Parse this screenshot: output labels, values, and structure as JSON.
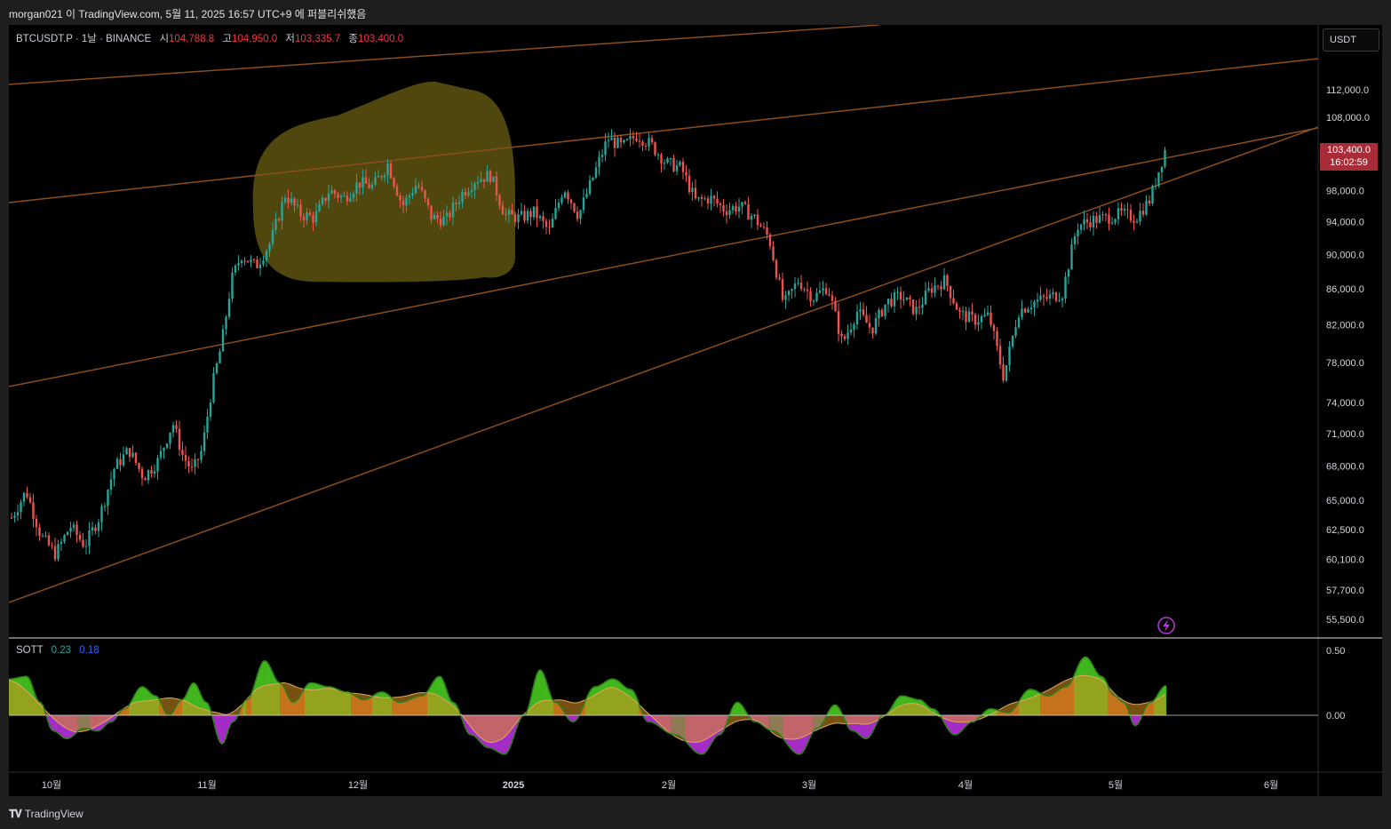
{
  "top_bar": {
    "text": "morgan021 이 TradingView.com, 5월 11, 2025 16:57 UTC+9 에 퍼블리쉬했음"
  },
  "legend": {
    "symbol": "BTCUSDT.P · 1날 · BINANCE",
    "open_label": "시",
    "open": "104,788.8",
    "high_label": "고",
    "high": "104,950.0",
    "low_label": "저",
    "low": "103,335.7",
    "close_label": "종",
    "close": "103,400.0"
  },
  "sott_legend": {
    "name": "SOTT",
    "value1": "0.23",
    "value2": "0.18"
  },
  "currency_button": "USDT",
  "price_tag": {
    "price": "103,400.0",
    "countdown": "16:02:59"
  },
  "footer": {
    "brand": "TradingView"
  },
  "icons": {
    "logo": "tradingview-logo-icon",
    "alert": "lightning-icon"
  },
  "colors": {
    "up": "#26a69a",
    "down": "#ef5350",
    "trendline": "#8b4e1a",
    "highlight": "#6e6214",
    "price_tag": "#a82c37",
    "sott_green": "#4ad41e",
    "sott_magenta": "#c033e8",
    "sott_orange": "#d9931f",
    "sott_blue": "#2962ff"
  },
  "chart_data": [
    {
      "type": "candlestick",
      "symbol": "BTCUSDT.P",
      "interval": "1D",
      "exchange": "BINANCE",
      "y_axis": {
        "scale": "log",
        "currency": "USDT",
        "ticks": [
          "112,000.0",
          "108,000.0",
          "98,000.0",
          "94,000.0",
          "90,000.0",
          "86,000.0",
          "82,000.0",
          "78,000.0",
          "74,000.0",
          "71,000.0",
          "68,000.0",
          "65,000.0",
          "62,500.0",
          "60,100.0",
          "57,700.0",
          "55,500.0"
        ],
        "tick_values": [
          112000,
          108000,
          98000,
          94000,
          90000,
          86000,
          82000,
          78000,
          74000,
          71000,
          68000,
          65000,
          62500,
          60100,
          57700,
          55500
        ]
      },
      "x_axis": {
        "ticks": [
          "10월",
          "11월",
          "12월",
          "2025",
          "2월",
          "3월",
          "4월",
          "5월",
          "6월"
        ]
      },
      "last_price": 103400,
      "approx_closes": [
        [
          0,
          63500
        ],
        [
          6,
          65800
        ],
        [
          12,
          62000
        ],
        [
          18,
          60500
        ],
        [
          24,
          62800
        ],
        [
          30,
          61200
        ],
        [
          36,
          63600
        ],
        [
          42,
          67800
        ],
        [
          48,
          69500
        ],
        [
          54,
          67000
        ],
        [
          60,
          68500
        ],
        [
          66,
          72000
        ],
        [
          70,
          69000
        ],
        [
          74,
          67500
        ],
        [
          78,
          69500
        ],
        [
          82,
          75500
        ],
        [
          86,
          80000
        ],
        [
          90,
          87000
        ],
        [
          94,
          90000
        ],
        [
          100,
          88600
        ],
        [
          106,
          91500
        ],
        [
          112,
          97500
        ],
        [
          118,
          95000
        ],
        [
          124,
          94500
        ],
        [
          130,
          98000
        ],
        [
          136,
          97000
        ],
        [
          142,
          99000
        ],
        [
          148,
          98500
        ],
        [
          154,
          101500
        ],
        [
          160,
          96000
        ],
        [
          166,
          99000
        ],
        [
          172,
          94500
        ],
        [
          178,
          94300
        ],
        [
          184,
          97500
        ],
        [
          190,
          99500
        ],
        [
          196,
          100000
        ],
        [
          202,
          94800
        ],
        [
          208,
          94500
        ],
        [
          214,
          95200
        ],
        [
          220,
          92800
        ],
        [
          226,
          98500
        ],
        [
          232,
          94800
        ],
        [
          238,
          99800
        ],
        [
          244,
          105000
        ],
        [
          250,
          103800
        ],
        [
          256,
          105500
        ],
        [
          262,
          104000
        ],
        [
          268,
          101600
        ],
        [
          274,
          101000
        ],
        [
          280,
          96600
        ],
        [
          286,
          97000
        ],
        [
          292,
          95500
        ],
        [
          298,
          96000
        ],
        [
          304,
          94500
        ],
        [
          310,
          92000
        ],
        [
          316,
          84200
        ],
        [
          322,
          87000
        ],
        [
          328,
          85000
        ],
        [
          334,
          86300
        ],
        [
          340,
          80000
        ],
        [
          346,
          83500
        ],
        [
          352,
          81500
        ],
        [
          358,
          84500
        ],
        [
          364,
          85200
        ],
        [
          370,
          83500
        ],
        [
          376,
          86000
        ],
        [
          382,
          87000
        ],
        [
          388,
          83200
        ],
        [
          394,
          82500
        ],
        [
          400,
          83000
        ],
        [
          406,
          76500
        ],
        [
          412,
          83500
        ],
        [
          418,
          84500
        ],
        [
          424,
          85000
        ],
        [
          430,
          85500
        ],
        [
          436,
          93500
        ],
        [
          442,
          94200
        ],
        [
          448,
          94500
        ],
        [
          454,
          95000
        ],
        [
          460,
          94500
        ],
        [
          466,
          96900
        ],
        [
          472,
          103400
        ]
      ],
      "trendlines": "three parallel ascending channel lines"
    },
    {
      "type": "area",
      "name": "SOTT",
      "y_axis": {
        "ticks": [
          "0.50",
          "0.00"
        ],
        "tick_values": [
          0.5,
          0.0
        ]
      },
      "values": {
        "value1": 0.23,
        "value2": 0.18
      }
    }
  ]
}
